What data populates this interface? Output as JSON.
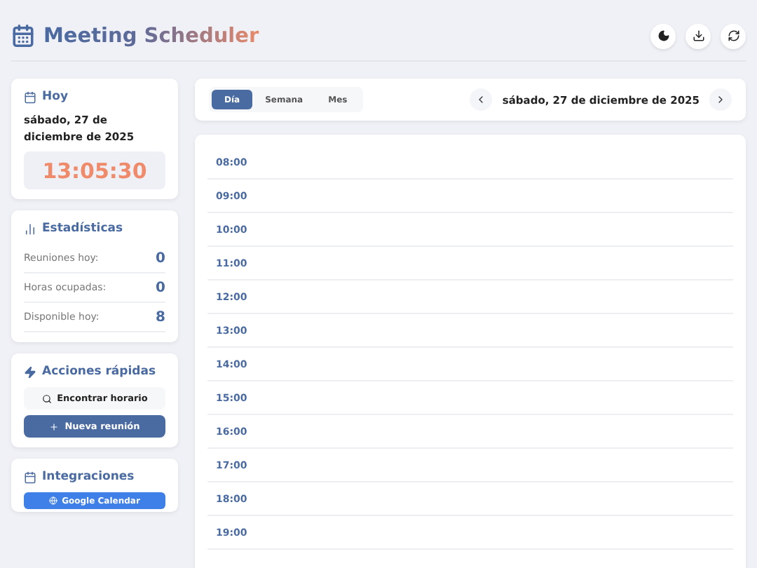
{
  "header": {
    "title": "Meeting Scheduler"
  },
  "today": {
    "title": "Hoy",
    "date": "sábado, 27 de diciembre de 2025",
    "clock": "13:05:30"
  },
  "stats": {
    "title": "Estadísticas",
    "rows": [
      {
        "label": "Reuniones hoy:",
        "value": "0"
      },
      {
        "label": "Horas ocupadas:",
        "value": "0"
      },
      {
        "label": "Disponible hoy:",
        "value": "8"
      }
    ]
  },
  "quick_actions": {
    "title": "Acciones rápidas",
    "buttons": [
      {
        "label": "Encontrar horario",
        "kind": "secondary"
      },
      {
        "label": "Nueva reunión",
        "kind": "primary"
      }
    ]
  },
  "integrations": {
    "title": "Integraciones",
    "buttons": [
      {
        "label": "Google Calendar"
      }
    ]
  },
  "view_tabs": [
    {
      "label": "Día",
      "selected": true
    },
    {
      "label": "Semana",
      "selected": false
    },
    {
      "label": "Mes",
      "selected": false
    }
  ],
  "date_nav": {
    "label": "sábado, 27 de diciembre de 2025"
  },
  "time_slots": [
    "08:00",
    "09:00",
    "10:00",
    "11:00",
    "12:00",
    "13:00",
    "14:00",
    "15:00",
    "16:00",
    "17:00",
    "18:00",
    "19:00"
  ]
}
